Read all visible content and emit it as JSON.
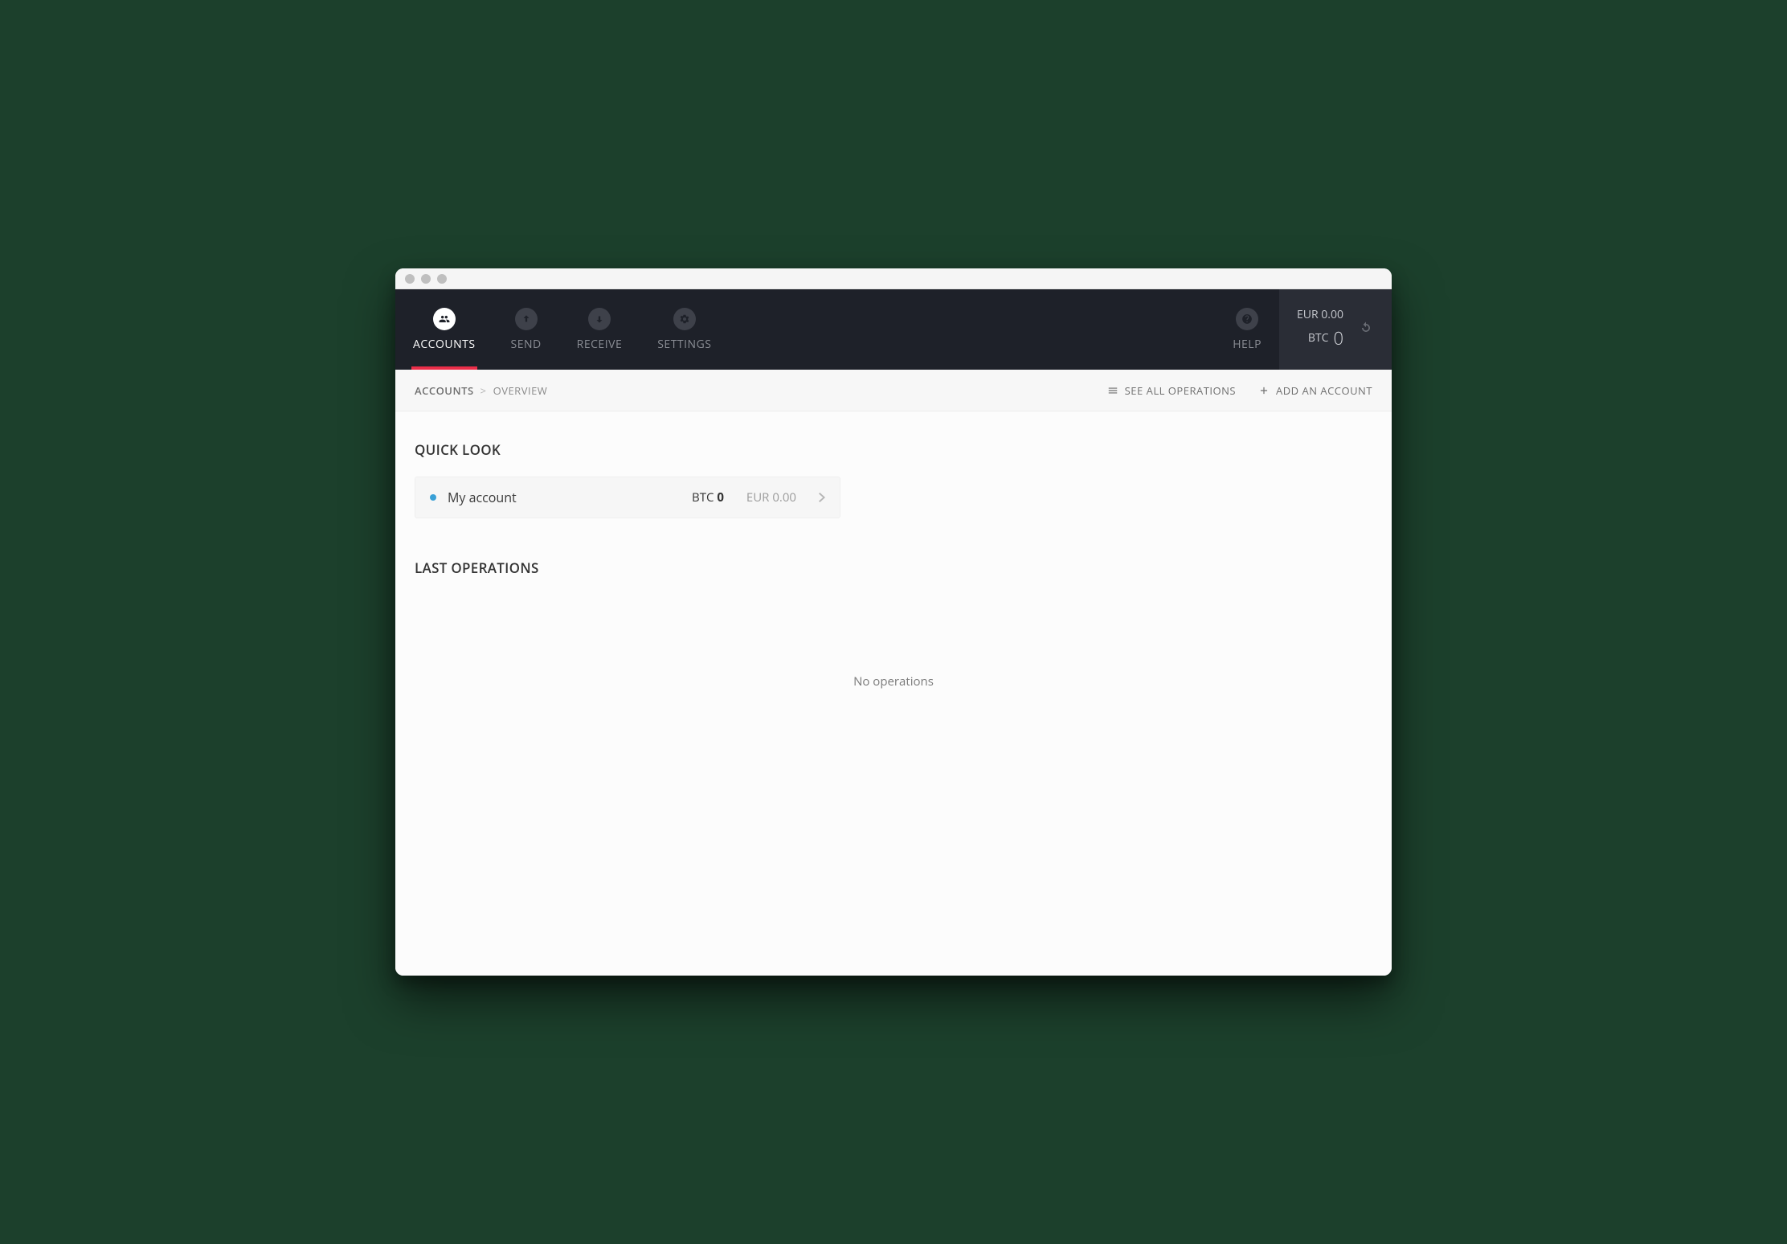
{
  "nav": {
    "accounts": "ACCOUNTS",
    "send": "SEND",
    "receive": "RECEIVE",
    "settings": "SETTINGS",
    "help": "HELP"
  },
  "balance": {
    "eur_line": "EUR 0.00",
    "btc_label": "BTC",
    "btc_value": "0"
  },
  "breadcrumb": {
    "root": "ACCOUNTS",
    "current": "OVERVIEW"
  },
  "subactions": {
    "see_all": "SEE ALL OPERATIONS",
    "add_account": "ADD AN ACCOUNT"
  },
  "sections": {
    "quick_look": "QUICK LOOK",
    "last_ops": "LAST OPERATIONS"
  },
  "account": {
    "name": "My account",
    "btc_label": "BTC",
    "btc_value": "0",
    "eur": "EUR 0.00"
  },
  "empty": {
    "no_ops": "No operations"
  }
}
